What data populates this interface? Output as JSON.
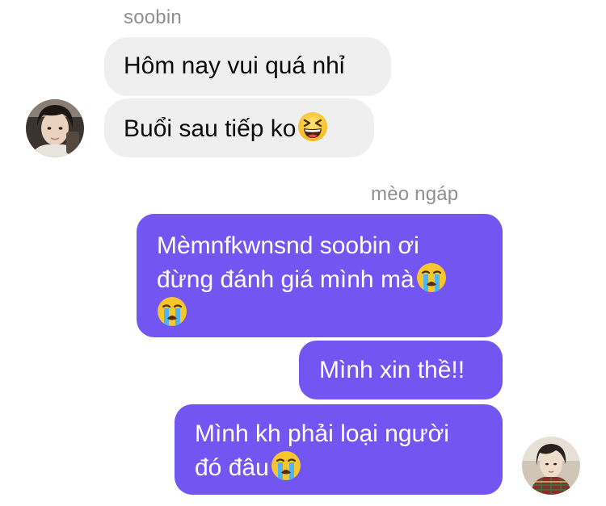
{
  "thread": {
    "incoming": {
      "sender_name": "soobin",
      "messages": [
        "Hôm nay vui quá nhỉ",
        "Buổi sau tiếp ko"
      ],
      "emojis": [
        "grinning-squinting-face-emoji"
      ]
    },
    "outgoing": {
      "sender_name": "mèo ngáp",
      "messages": [
        {
          "line1": "Mèmnfkwnsnd soobin ơi",
          "line2": "đừng đánh giá mình mà"
        },
        "Mình xin thề!!",
        {
          "line1": "Mình kh phải loại người",
          "line2": "đó đâu"
        }
      ],
      "emojis": [
        "loudly-crying-face-emoji"
      ]
    }
  },
  "colors": {
    "incoming_bubble": "#efeff0",
    "outgoing_bubble": "#7356f2",
    "sender_name": "#8e8e93",
    "outgoing_text": "#ffffff"
  }
}
